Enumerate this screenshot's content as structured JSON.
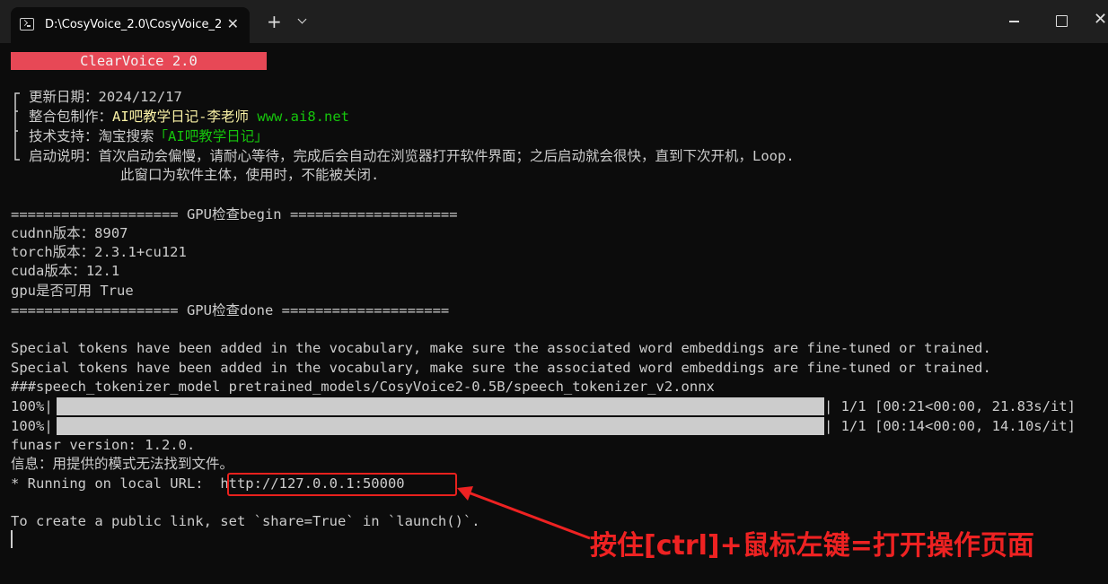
{
  "window": {
    "tab_title": "D:\\CosyVoice_2.0\\CosyVoice_2",
    "tab_close": "✕",
    "new_tab": "+"
  },
  "terminal": {
    "banner": "ClearVoice 2.0",
    "info": {
      "date_label": "更新日期：",
      "date_value": "2024/12/17",
      "maker_label": "整合包制作：",
      "maker_value": "AI吧教学日记-李老师",
      "maker_site": "www.ai8.net",
      "support_label": "技术支持：",
      "support_value_prefix": "淘宝搜索",
      "support_value_name": "「AI吧教学日记」",
      "start_label": "启动说明：",
      "start_line1": "首次启动会偏慢，请耐心等待，完成后会自动在浏览器打开软件界面；之后启动就会很快，直到下次开机，Loop.",
      "start_line2": "此窗口为软件主体，使用时，不能被关闭."
    },
    "gpu_begin": "==================== GPU检查begin ====================",
    "cudnn": "cudnn版本：8907",
    "torch": "torch版本：2.3.1+cu121",
    "cuda": "cuda版本：12.1",
    "gpu_available": "gpu是否可用 True",
    "gpu_done": "==================== GPU检查done ====================",
    "warning1": "Special tokens have been added in the vocabulary, make sure the associated word embeddings are fine-tuned or trained.",
    "warning2": "Special tokens have been added in the vocabulary, make sure the associated word embeddings are fine-tuned or trained.",
    "tokenizer": "###speech_tokenizer_model pretrained_models/CosyVoice2-0.5B/speech_tokenizer_v2.onnx",
    "progress": [
      {
        "percent": "100%|",
        "fraction": 1.0,
        "stats": "| 1/1 [00:21<00:00, 21.83s/it]"
      },
      {
        "percent": "100%|",
        "fraction": 1.0,
        "stats": "| 1/1 [00:14<00:00, 14.10s/it]"
      }
    ],
    "funasr": "funasr version: 1.2.0.",
    "info_msg": "信息：用提供的模式无法找到文件。",
    "running_label": "* Running on local URL:",
    "running_url": "http://127.0.0.1:50000",
    "public_link": "To create a public link, set `share=True` in `launch()`."
  },
  "annotation": {
    "text": "按住[ctrl]+鼠标左键=打开操作页面",
    "color": "#ee2222"
  }
}
